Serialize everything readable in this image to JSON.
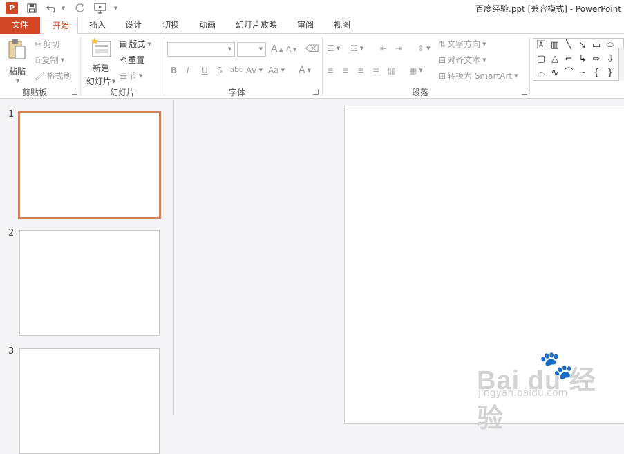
{
  "titlebar": {
    "app_icon": "P",
    "window_title": "百度经验.ppt [兼容模式] - PowerPoint",
    "quick_access": {
      "save_icon": "save-icon",
      "undo_icon": "undo-icon",
      "redo_icon": "redo-icon",
      "slideshow_icon": "start-slideshow-icon",
      "customize_icon": "customize-qat-icon"
    }
  },
  "tabs": [
    {
      "label": "文件"
    },
    {
      "label": "开始"
    },
    {
      "label": "插入"
    },
    {
      "label": "设计"
    },
    {
      "label": "切换"
    },
    {
      "label": "动画"
    },
    {
      "label": "幻灯片放映"
    },
    {
      "label": "审阅"
    },
    {
      "label": "视图"
    }
  ],
  "ribbon": {
    "clipboard": {
      "group_label": "剪贴板",
      "paste": "粘贴",
      "cut": "剪切",
      "copy": "复制",
      "format_painter": "格式刷"
    },
    "slides": {
      "group_label": "幻灯片",
      "new_slide_line1": "新建",
      "new_slide_line2": "幻灯片",
      "layout": "版式",
      "reset": "重置",
      "section": "节"
    },
    "font": {
      "group_label": "字体",
      "font_name": "",
      "font_size": "",
      "grow_icon": "A",
      "shrink_icon": "A",
      "clear_icon": "clear-formatting-icon",
      "bold": "B",
      "italic": "I",
      "underline": "U",
      "shadow": "S",
      "strike": "abc",
      "spacing": "AV",
      "case": "Aa",
      "color": "A"
    },
    "paragraph": {
      "group_label": "段落",
      "text_direction": "文字方向",
      "align_text": "对齐文本",
      "convert_smartart": "转换为 SmartArt"
    }
  },
  "shapes": [
    "text-box",
    "vertical-text-box",
    "line",
    "arrow-line",
    "rectangle",
    "oval",
    "rounded-rectangle",
    "triangle",
    "elbow-connector",
    "elbow-arrow",
    "right-arrow",
    "down-arrow",
    "freeform",
    "scribble",
    "arc",
    "curve",
    "left-brace",
    "right-brace"
  ],
  "thumbnails": [
    {
      "number": "1"
    },
    {
      "number": "2"
    },
    {
      "number": "3"
    }
  ],
  "colors": {
    "accent": "#d24726",
    "selected_border": "#d5815d",
    "background": "#f4f3f5"
  },
  "watermark": {
    "main": "Bai du 经验",
    "sub": "jingyan.baidu.com"
  }
}
